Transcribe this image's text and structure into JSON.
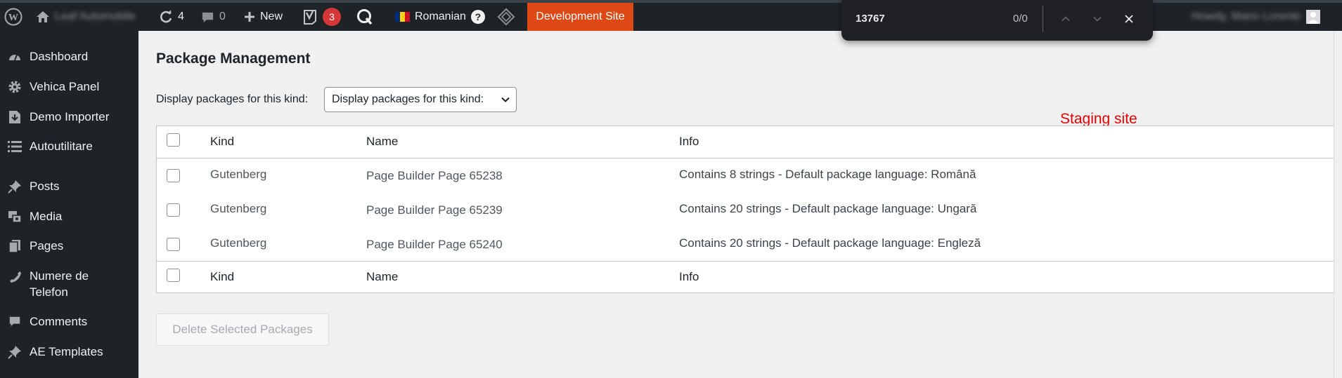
{
  "adminbar": {
    "site_name": "Leaf Automobile",
    "updates_count": "4",
    "comments_count": "0",
    "new_label": "New",
    "yoast_badge": "3",
    "language_label": "Romanian",
    "help_symbol": "?",
    "dev_site_label": "Development Site",
    "user_greeting": "Howdy, Mario Lorente"
  },
  "findbar": {
    "query": "13767",
    "match_count": "0/0"
  },
  "sidebar": {
    "items": [
      {
        "label": "Dashboard",
        "icon": "dashboard-icon"
      },
      {
        "label": "Vehica Panel",
        "icon": "gear-icon"
      },
      {
        "label": "Demo Importer",
        "icon": "import-icon"
      },
      {
        "label": "Autoutilitare",
        "icon": "list-icon"
      },
      {
        "label": "Posts",
        "icon": "pin-icon"
      },
      {
        "label": "Media",
        "icon": "media-icon"
      },
      {
        "label": "Pages",
        "icon": "pages-icon"
      },
      {
        "label": "Numere de Telefon",
        "icon": "phone-icon"
      },
      {
        "label": "Comments",
        "icon": "comment-icon"
      },
      {
        "label": "AE Templates",
        "icon": "pin-icon"
      }
    ]
  },
  "main": {
    "title": "Package Management",
    "filter_label": "Display packages for this kind:",
    "filter_selected": "Display packages for this kind:",
    "staging_label": "Staging site",
    "table": {
      "columns": [
        "Kind",
        "Name",
        "Info"
      ],
      "rows": [
        {
          "kind": "Gutenberg",
          "name": "Page Builder Page 65238",
          "info": "Contains 8 strings - Default package language: Română"
        },
        {
          "kind": "Gutenberg",
          "name": "Page Builder Page 65239",
          "info": "Contains 20 strings - Default package language: Ungară"
        },
        {
          "kind": "Gutenberg",
          "name": "Page Builder Page 65240",
          "info": "Contains 20 strings - Default package language: Engleză"
        }
      ]
    },
    "delete_button": "Delete Selected Packages"
  },
  "colors": {
    "admin_bar_bg": "#1d2327",
    "dev_site_bg": "#dd4814",
    "yoast_badge_bg": "#d63638",
    "staging_text": "#e00000",
    "find_bar_bg": "#202124"
  }
}
